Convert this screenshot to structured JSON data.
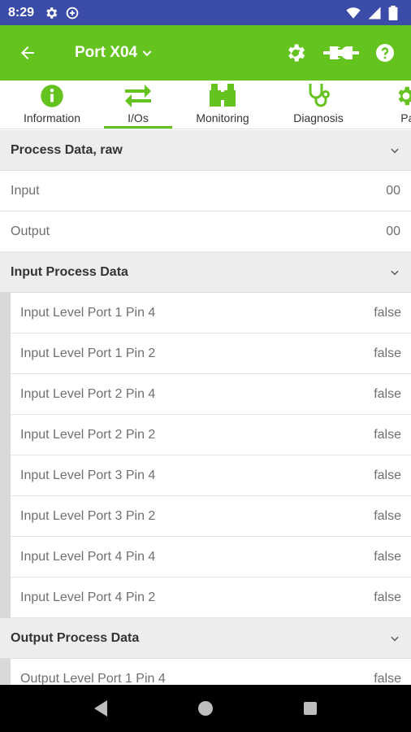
{
  "status_bar": {
    "time": "8:29"
  },
  "app_bar": {
    "title": "Port X04"
  },
  "tabs": [
    {
      "label": "Information",
      "icon": "info-icon"
    },
    {
      "label": "I/Os",
      "icon": "swap-arrows-icon",
      "active": true
    },
    {
      "label": "Monitoring",
      "icon": "binoculars-icon"
    },
    {
      "label": "Diagnosis",
      "icon": "stethoscope-icon"
    },
    {
      "label": "Para",
      "icon": "gear-icon"
    }
  ],
  "colors": {
    "primary": "#64c31e",
    "status_bar": "#3b4ba8",
    "section_bg": "#ededed",
    "nav_bar": "#000000"
  },
  "sections": {
    "raw": {
      "title": "Process Data, raw",
      "rows": [
        {
          "label": "Input",
          "value": "00"
        },
        {
          "label": "Output",
          "value": "00"
        }
      ]
    },
    "input": {
      "title": "Input Process Data",
      "rows": [
        {
          "label": "Input Level Port 1 Pin 4",
          "value": "false"
        },
        {
          "label": "Input Level Port 1 Pin 2",
          "value": "false"
        },
        {
          "label": "Input Level Port 2 Pin 4",
          "value": "false"
        },
        {
          "label": "Input Level Port 2 Pin 2",
          "value": "false"
        },
        {
          "label": "Input Level Port 3 Pin 4",
          "value": "false"
        },
        {
          "label": "Input Level Port 3 Pin 2",
          "value": "false"
        },
        {
          "label": "Input Level Port 4 Pin 4",
          "value": "false"
        },
        {
          "label": "Input Level Port 4 Pin 2",
          "value": "false"
        }
      ]
    },
    "output": {
      "title": "Output Process Data",
      "rows": [
        {
          "label": "Output Level Port 1 Pin 4",
          "value": "false"
        }
      ]
    }
  }
}
